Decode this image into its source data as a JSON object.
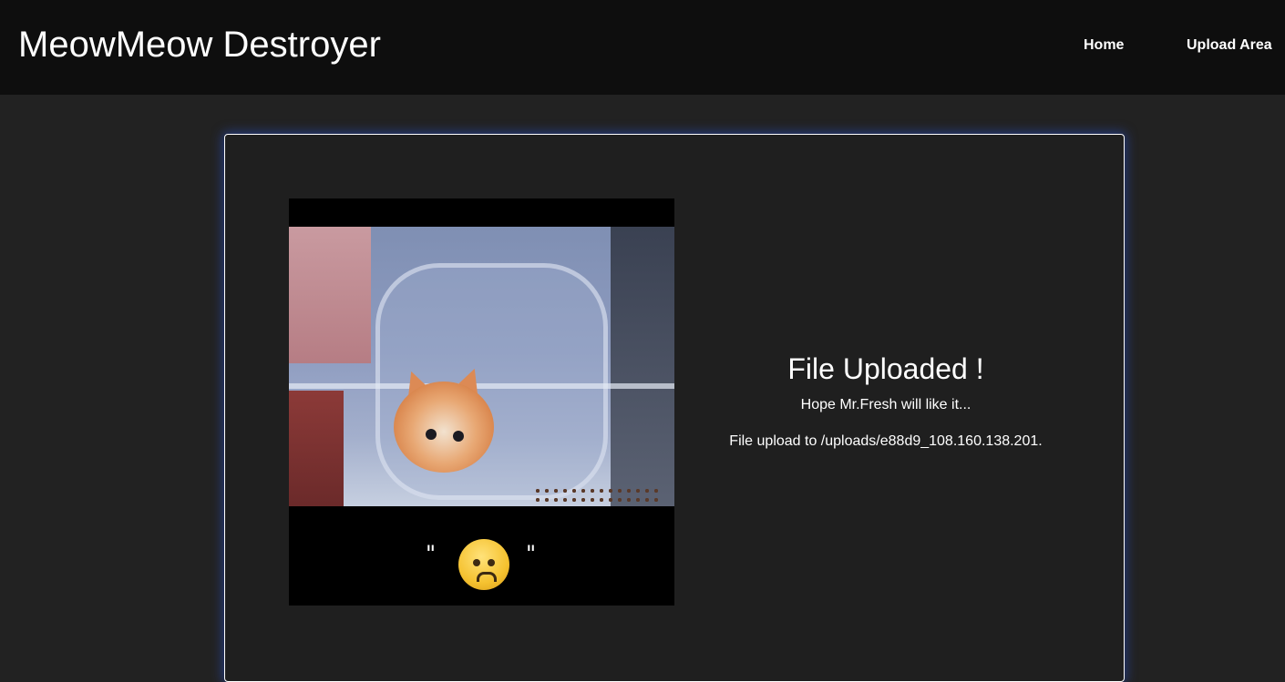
{
  "header": {
    "title": "MeowMeow Destroyer",
    "nav": {
      "home_label": "Home",
      "upload_label": "Upload Area"
    }
  },
  "main": {
    "result_title": "File Uploaded !",
    "subtitle": "Hope Mr.Fresh will like it...",
    "upload_path_text": "File upload to /uploads/e88d9_108.160.138.201.",
    "image": {
      "caption_quote_left": "\"",
      "caption_quote_right": "\""
    }
  },
  "colors": {
    "header_bg": "#0e0e0e",
    "page_bg": "#222222",
    "card_bg": "#1f1f1f",
    "card_glow": "#2850c8"
  }
}
